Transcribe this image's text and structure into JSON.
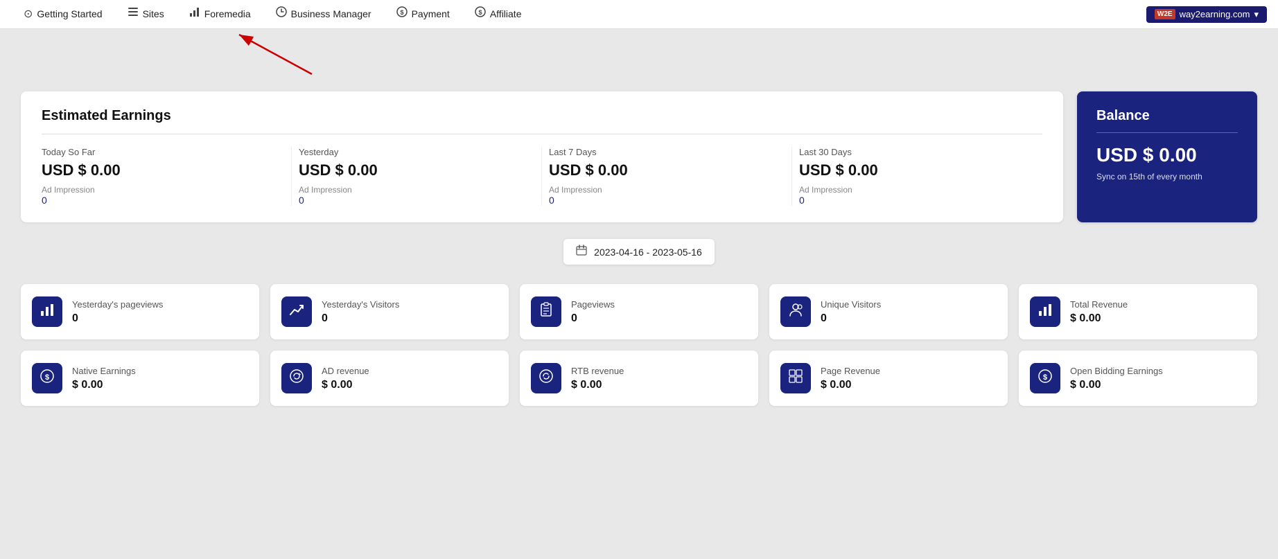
{
  "navbar": {
    "items": [
      {
        "id": "getting-started",
        "label": "Getting Started",
        "icon": "⊙"
      },
      {
        "id": "sites",
        "label": "Sites",
        "icon": "☰"
      },
      {
        "id": "foremedia",
        "label": "Foremedia",
        "icon": "▐▌▌"
      },
      {
        "id": "business-manager",
        "label": "Business Manager",
        "icon": "⏱"
      },
      {
        "id": "payment",
        "label": "Payment",
        "icon": "ⓢ"
      },
      {
        "id": "affiliate",
        "label": "Affiliate",
        "icon": "ⓢ"
      }
    ],
    "brand": {
      "logo": "W2E",
      "label": "way2earning.com"
    }
  },
  "estimated_earnings": {
    "title": "Estimated Earnings",
    "columns": [
      {
        "period": "Today So Far",
        "amount": "USD $ 0.00",
        "impression_label": "Ad Impression",
        "impression_value": "0"
      },
      {
        "period": "Yesterday",
        "amount": "USD $ 0.00",
        "impression_label": "Ad Impression",
        "impression_value": "0"
      },
      {
        "period": "Last 7 Days",
        "amount": "USD $ 0.00",
        "impression_label": "Ad Impression",
        "impression_value": "0"
      },
      {
        "period": "Last 30 Days",
        "amount": "USD $ 0.00",
        "impression_label": "Ad Impression",
        "impression_value": "0"
      }
    ]
  },
  "balance": {
    "title": "Balance",
    "amount": "USD $ 0.00",
    "sync_note": "Sync on 15th of every month"
  },
  "date_range": {
    "value": "2023-04-16 - 2023-05-16"
  },
  "stat_cards_row1": [
    {
      "id": "yesterdays-pageviews",
      "label": "Yesterday's pageviews",
      "value": "0",
      "icon_type": "bar-chart"
    },
    {
      "id": "yesterdays-visitors",
      "label": "Yesterday's Visitors",
      "value": "0",
      "icon_type": "trend-up"
    },
    {
      "id": "pageviews",
      "label": "Pageviews",
      "value": "0",
      "icon_type": "clipboard"
    },
    {
      "id": "unique-visitors",
      "label": "Unique Visitors",
      "value": "0",
      "icon_type": "person"
    },
    {
      "id": "total-revenue",
      "label": "Total Revenue",
      "value": "$ 0.00",
      "icon_type": "bar-chart"
    }
  ],
  "stat_cards_row2": [
    {
      "id": "native-earnings",
      "label": "Native Earnings",
      "value": "$ 0.00",
      "icon_type": "dollar-circle"
    },
    {
      "id": "ad-revenue",
      "label": "AD revenue",
      "value": "$ 0.00",
      "icon_type": "refresh-circle"
    },
    {
      "id": "rtb-revenue",
      "label": "RTB revenue",
      "value": "$ 0.00",
      "icon_type": "refresh"
    },
    {
      "id": "page-revenue",
      "label": "Page Revenue",
      "value": "$ 0.00",
      "icon_type": "grid"
    },
    {
      "id": "open-bidding-earnings",
      "label": "Open Bidding Earnings",
      "value": "$ 0.00",
      "icon_type": "dollar-circle"
    }
  ]
}
